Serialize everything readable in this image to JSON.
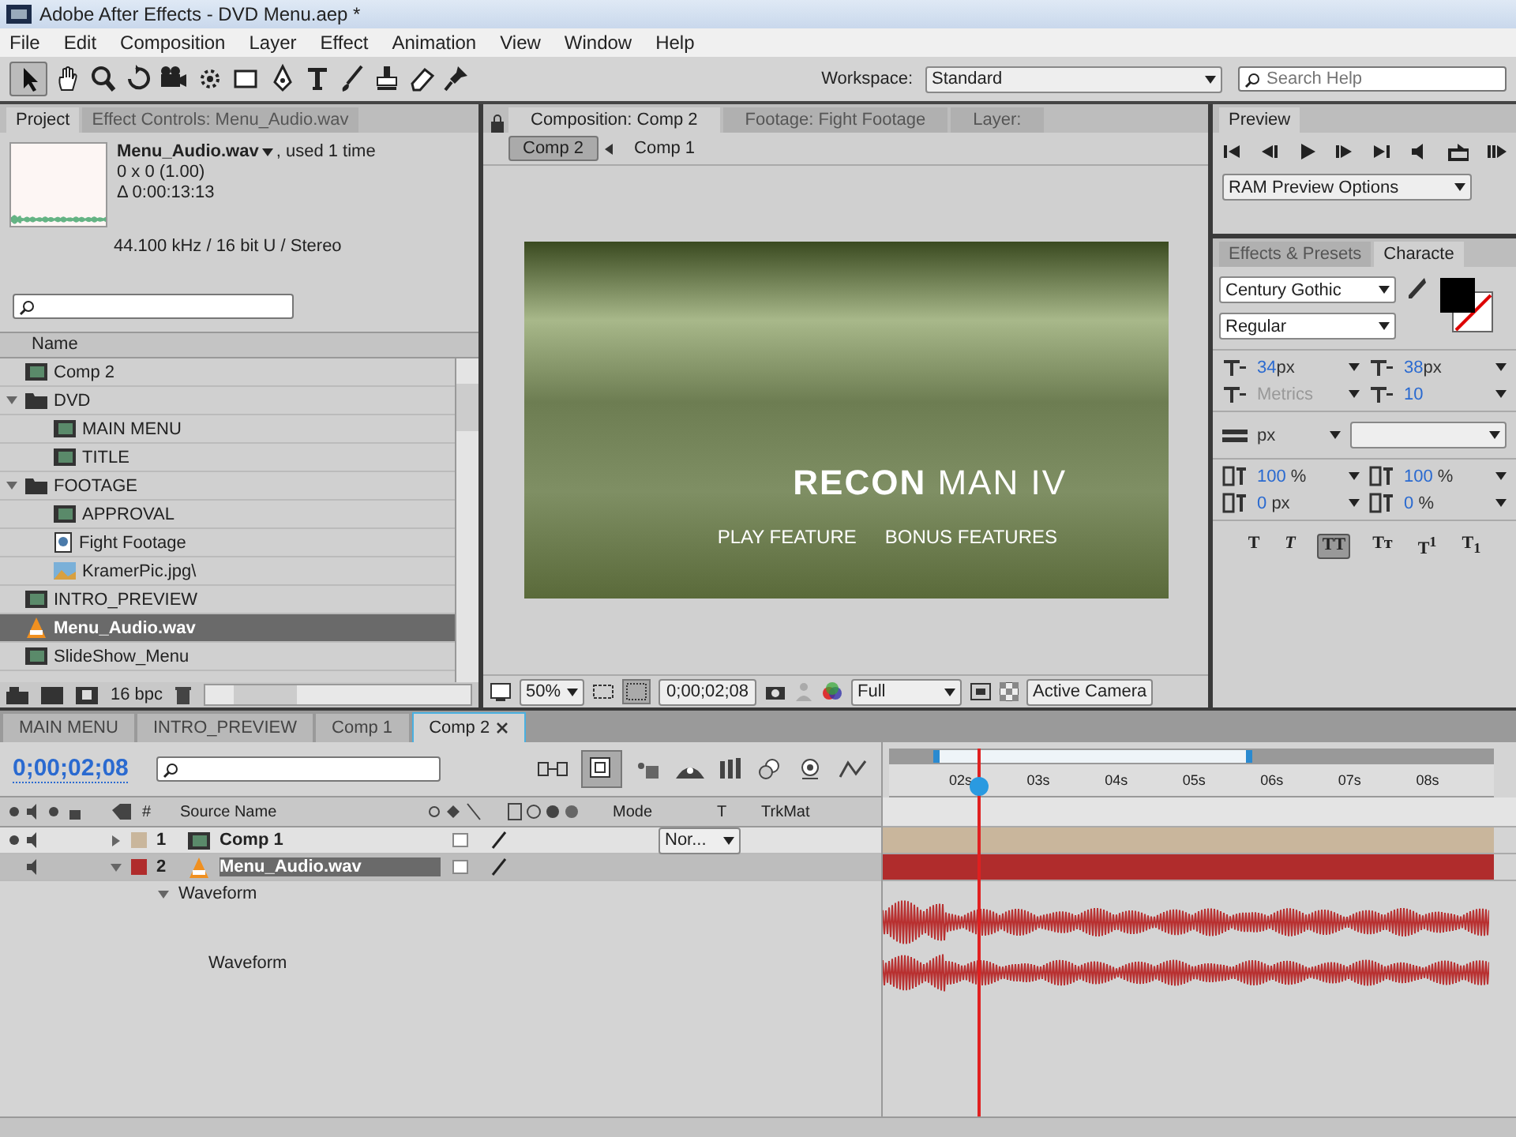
{
  "window": {
    "title": "Adobe After Effects - DVD Menu.aep *"
  },
  "menu": [
    "File",
    "Edit",
    "Composition",
    "Layer",
    "Effect",
    "Animation",
    "View",
    "Window",
    "Help"
  ],
  "toolbar": {
    "workspace_label": "Workspace:",
    "workspace": "Standard",
    "search_placeholder": "Search Help"
  },
  "project": {
    "tabs": [
      {
        "label": "Project",
        "selected": true
      },
      {
        "label": "Effect Controls: Menu_Audio.wav",
        "selected": false
      }
    ],
    "info": {
      "name": "Menu_Audio.wav",
      "usage": ", used 1 time",
      "dimensions": "0 x 0 (1.00)",
      "duration": "Δ 0:00:13:13",
      "audio": "44.100 kHz / 16 bit U / Stereo"
    },
    "column": "Name",
    "items": [
      {
        "name": "Comp 2",
        "kind": "comp",
        "selected": false
      },
      {
        "name": "DVD",
        "kind": "folder",
        "selected": false,
        "expanded": true,
        "children": [
          {
            "name": "MAIN MENU",
            "kind": "comp",
            "selected": false
          },
          {
            "name": "TITLE",
            "kind": "comp",
            "selected": false
          }
        ]
      },
      {
        "name": "FOOTAGE",
        "kind": "folder",
        "selected": false,
        "expanded": true,
        "children": [
          {
            "name": "APPROVAL",
            "kind": "comp",
            "selected": false
          },
          {
            "name": "Fight Footage",
            "kind": "footage",
            "selected": false
          },
          {
            "name": "KramerPic.jpg\\",
            "kind": "image",
            "selected": false
          }
        ]
      },
      {
        "name": "INTRO_PREVIEW",
        "kind": "comp",
        "selected": false
      },
      {
        "name": "Menu_Audio.wav",
        "kind": "audio",
        "selected": true
      },
      {
        "name": "SlideShow_Menu",
        "kind": "comp",
        "selected": false
      }
    ],
    "bit_depth": "16 bpc"
  },
  "composition": {
    "tabs": [
      {
        "label": "Composition: Comp 2",
        "selected": true
      },
      {
        "label": "Footage: Fight Footage",
        "selected": false
      },
      {
        "label": "Layer:",
        "selected": false
      }
    ],
    "breadcrumbs": [
      {
        "label": "Comp 2",
        "selected": true
      },
      {
        "label": "Comp 1",
        "selected": false
      }
    ],
    "frame": {
      "title": "**RECON** MAN IV",
      "buttons": [
        "PLAY FEATURE",
        "BONUS FEATURES"
      ]
    },
    "footer": {
      "zoom": "50%",
      "timecode": "0;00;02;08",
      "resolution": "Full",
      "camera": "Active Camera"
    }
  },
  "preview": {
    "tab": "Preview",
    "options": "RAM Preview Options"
  },
  "character": {
    "tabs": [
      {
        "label": "Effects & Presets",
        "selected": false
      },
      {
        "label": "Characte",
        "selected": true
      }
    ],
    "font": "Century Gothic",
    "style": "Regular",
    "metrics": [
      {
        "value": "34",
        "unit": "px",
        "disabled": false
      },
      {
        "value": "38",
        "unit": "px",
        "disabled": false
      },
      {
        "value": "Metrics",
        "disabled": true
      },
      {
        "value": "10",
        "disabled": false
      }
    ],
    "stroke_unit": "px",
    "scales": [
      {
        "value": "100",
        "unit": "%"
      },
      {
        "value": "100",
        "unit": "%"
      },
      {
        "value": "0",
        "unit": "px"
      },
      {
        "value": "0",
        "unit": "%"
      }
    ],
    "styles": [
      {
        "label": "T",
        "kind": "bold",
        "selected": false
      },
      {
        "label": "T",
        "kind": "italic",
        "selected": false
      },
      {
        "label": "TT",
        "kind": "caps",
        "selected": true
      },
      {
        "label": "Tт",
        "kind": "smallcaps",
        "selected": false
      },
      {
        "label": "T$^{1}$",
        "kind": "super",
        "selected": false
      },
      {
        "label": "T$_{1}$",
        "kind": "sub",
        "selected": false
      }
    ]
  },
  "timeline": {
    "tabs": [
      {
        "label": "MAIN MENU",
        "selected": false
      },
      {
        "label": "INTRO_PREVIEW",
        "selected": false
      },
      {
        "label": "Comp 1",
        "selected": false
      },
      {
        "label": "Comp 2",
        "selected": true
      }
    ],
    "timecode": "0;00;02;08",
    "columns": {
      "number": "#",
      "source": "Source Name",
      "mode": "Mode",
      "t": "T",
      "trkmat": "TrkMat"
    },
    "layers": [
      {
        "number": "1",
        "name": "Comp 1",
        "kind": "comp",
        "color": "#c9b69c",
        "selected": false,
        "expanded": false,
        "visible": true,
        "mode": "Nor..."
      },
      {
        "number": "2",
        "name": "Menu_Audio.wav",
        "kind": "audio",
        "color": "#b02c2c",
        "selected": true,
        "expanded": true,
        "visible": false
      }
    ],
    "property": "Waveform",
    "property_value": "Waveform",
    "ruler": [
      "02s",
      "03s",
      "04s",
      "05s",
      "06s",
      "07s",
      "08s"
    ]
  }
}
